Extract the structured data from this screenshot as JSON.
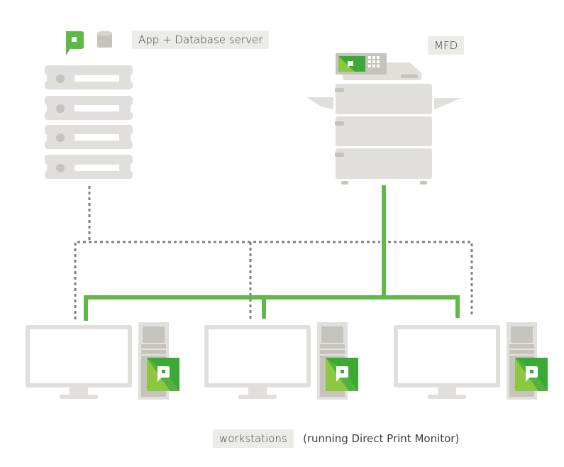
{
  "labels": {
    "server": "App + Database server",
    "mfd": "MFD",
    "workstations": "workstations",
    "workstations_note": "(running Direct Print Monitor)"
  },
  "colors": {
    "green": "#5fb946",
    "green_light": "#8dc63f",
    "green_dark": "#3aaa35",
    "device_gray": "#e0dfdb",
    "device_dark": "#c5c3bc",
    "dotted_gray": "#808080",
    "label_bg": "#ebebe8"
  },
  "workstations": [
    {
      "id": "workstation-1"
    },
    {
      "id": "workstation-2"
    },
    {
      "id": "workstation-3"
    }
  ]
}
